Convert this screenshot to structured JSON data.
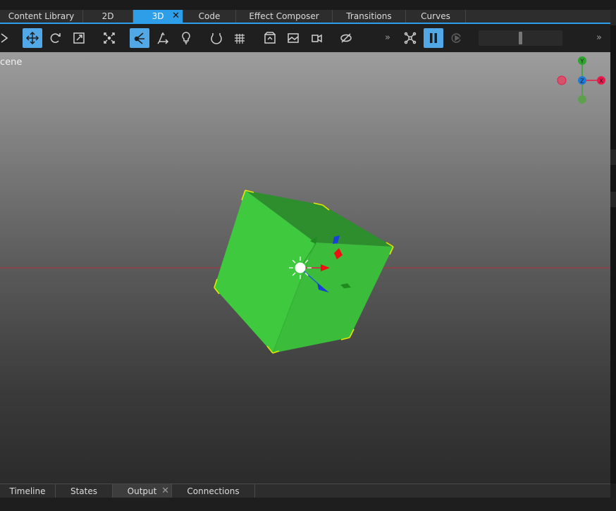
{
  "top_tabs": [
    {
      "label": "Content Library"
    },
    {
      "label": "2D"
    },
    {
      "label": "3D",
      "active": true
    },
    {
      "label": "Code"
    },
    {
      "label": "Effect Composer"
    },
    {
      "label": "Transitions"
    },
    {
      "label": "Curves"
    }
  ],
  "close_glyph": "✕",
  "toolbar": {
    "overflow_glyph": "»",
    "icons": [
      "select-arrow-icon",
      "move-tool-icon",
      "rotate-tool-icon",
      "scale-tool-icon",
      "fit-view-icon",
      "orientation-toggle-icon",
      "perspective-toggle-icon",
      "light-bulb-icon",
      "snap-toggle-icon",
      "grid-toggle-icon",
      "camera-view-icon",
      "background-color-icon",
      "camera-icon",
      "visibility-toggle-icon",
      "particle-editor-icon",
      "pause-animation-icon",
      "restart-animation-icon"
    ],
    "active_icons": [
      "move-tool-icon",
      "orientation-toggle-icon",
      "pause-animation-icon"
    ],
    "animation_speed": 0.5
  },
  "viewport": {
    "label": "cene",
    "object_color": "#3ec93e",
    "selection_color": "#e6e600",
    "gizmo_colors": {
      "x": "#e8194b",
      "y": "#2fa52f",
      "z": "#1f7bd6"
    },
    "axis_labels": {
      "x": "X",
      "y": "Y",
      "z": "Z"
    }
  },
  "bottom_tabs": [
    {
      "label": "Timeline"
    },
    {
      "label": "States"
    },
    {
      "label": "Output",
      "active": true
    },
    {
      "label": "Connections"
    }
  ]
}
